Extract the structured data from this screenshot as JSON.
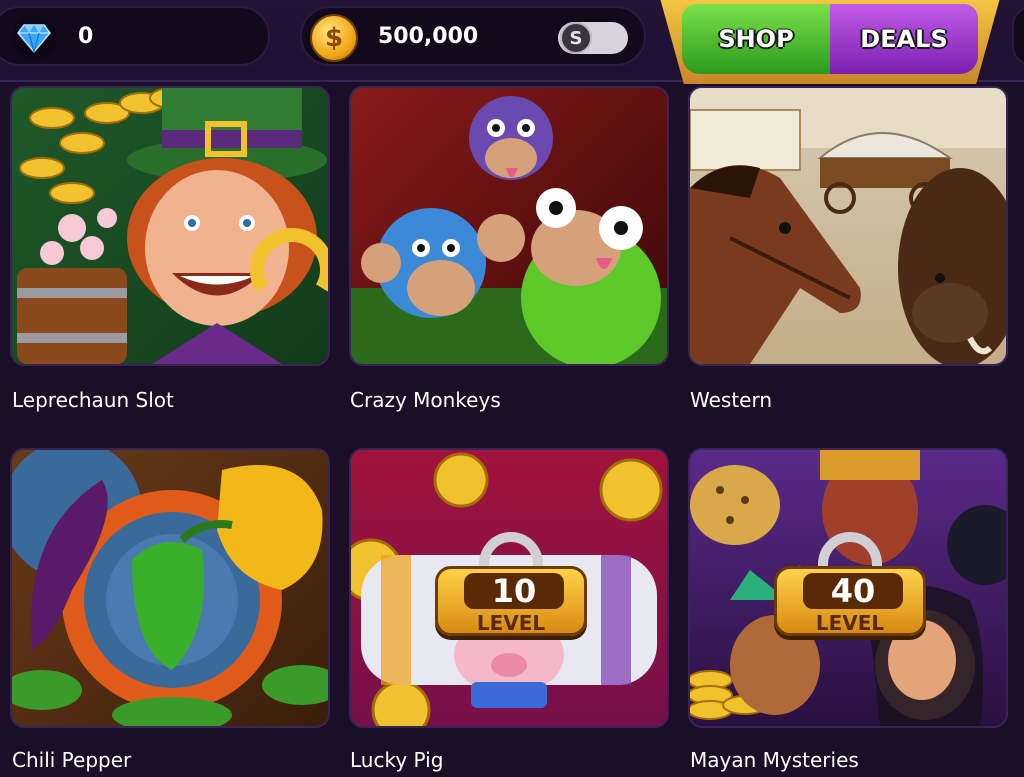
{
  "currency": {
    "gems": "0",
    "coins": "500,000",
    "coin_symbol": "$",
    "toggle_symbol": "S"
  },
  "nav": {
    "shop_label": "SHOP",
    "deals_label": "DEALS"
  },
  "games": [
    {
      "title": "Leprechaun Slot",
      "locked": false
    },
    {
      "title": "Crazy Monkeys",
      "locked": false
    },
    {
      "title": "Western",
      "locked": false
    },
    {
      "title": "Chili Pepper",
      "locked": false
    },
    {
      "title": "Lucky Pig",
      "locked": true,
      "unlock_level": "10",
      "level_word": "LEVEL"
    },
    {
      "title": "Mayan Mysteries",
      "locked": true,
      "unlock_level": "40",
      "level_word": "LEVEL"
    }
  ],
  "colors": {
    "background": "#1a0f26",
    "shop_green": "#2b9a1c",
    "deals_purple": "#7a1fb0",
    "gold_frame": "#f5c842"
  },
  "icons": {
    "gem": "diamond-icon",
    "coin": "coin-icon",
    "toggle": "toggle-icon"
  }
}
